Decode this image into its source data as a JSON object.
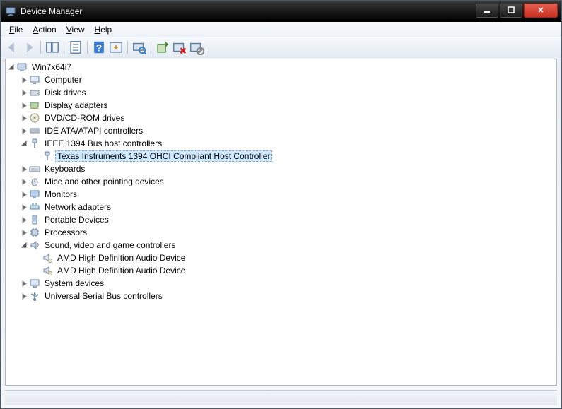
{
  "title": "Device Manager",
  "menu": {
    "file": "File",
    "action": "Action",
    "view": "View",
    "help": "Help"
  },
  "root": "Win7x64i7",
  "nodes": {
    "computer": "Computer",
    "disk": "Disk drives",
    "display": "Display adapters",
    "dvd": "DVD/CD-ROM drives",
    "ide": "IDE ATA/ATAPI controllers",
    "ieee1394": "IEEE 1394 Bus host controllers",
    "ieee1394_child": "Texas Instruments 1394 OHCI Compliant Host Controller",
    "keyboards": "Keyboards",
    "mice": "Mice and other pointing devices",
    "monitors": "Monitors",
    "network": "Network adapters",
    "portable": "Portable Devices",
    "processors": "Processors",
    "sound": "Sound, video and game controllers",
    "sound_child1": "AMD High Definition Audio Device",
    "sound_child2": "AMD High Definition Audio Device",
    "system": "System devices",
    "usb": "Universal Serial Bus controllers"
  }
}
